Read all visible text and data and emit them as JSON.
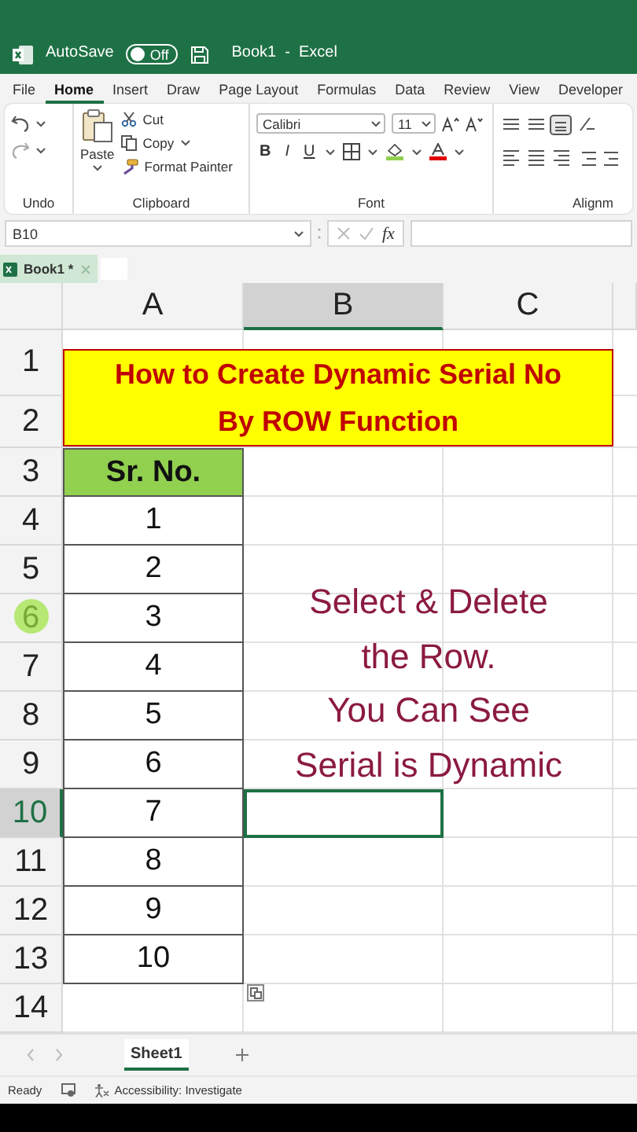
{
  "title_bar": {
    "autosave_label": "AutoSave",
    "autosave_state": "Off",
    "autosave_on": false,
    "document_title": "Book1  -  Excel"
  },
  "ribbon_tabs": [
    {
      "label": "File",
      "selected": false
    },
    {
      "label": "Home",
      "selected": true
    },
    {
      "label": "Insert",
      "selected": false
    },
    {
      "label": "Draw",
      "selected": false
    },
    {
      "label": "Page Layout",
      "selected": false
    },
    {
      "label": "Formulas",
      "selected": false
    },
    {
      "label": "Data",
      "selected": false
    },
    {
      "label": "Review",
      "selected": false
    },
    {
      "label": "View",
      "selected": false
    },
    {
      "label": "Developer",
      "selected": false
    }
  ],
  "ribbon": {
    "undo_group": "Undo",
    "paste": "Paste",
    "cut": "Cut",
    "copy": "Copy",
    "format_painter": "Format Painter",
    "clipboard_group": "Clipboard",
    "font_name": "Calibri",
    "font_size": "11",
    "bold": "B",
    "italic": "I",
    "underline": "U",
    "font_group": "Font",
    "alignment_group": "Alignm"
  },
  "formula_bar": {
    "name_box": "B10",
    "fx": "fx"
  },
  "workbook_tab": {
    "label": "Book1 *"
  },
  "sheet": {
    "columns": [
      {
        "label": "A",
        "selected": false
      },
      {
        "label": "B",
        "selected": true
      },
      {
        "label": "C",
        "selected": false
      }
    ],
    "rows": [
      {
        "number": "1",
        "selected": false,
        "pointer": false
      },
      {
        "number": "2",
        "selected": false,
        "pointer": false
      },
      {
        "number": "3",
        "selected": false,
        "pointer": false
      },
      {
        "number": "4",
        "selected": false,
        "pointer": false
      },
      {
        "number": "5",
        "selected": false,
        "pointer": false
      },
      {
        "number": "6",
        "selected": false,
        "pointer": true
      },
      {
        "number": "7",
        "selected": false,
        "pointer": false
      },
      {
        "number": "8",
        "selected": false,
        "pointer": false
      },
      {
        "number": "9",
        "selected": false,
        "pointer": false
      },
      {
        "number": "10",
        "selected": true,
        "pointer": false
      },
      {
        "number": "11",
        "selected": false,
        "pointer": false
      },
      {
        "number": "12",
        "selected": false,
        "pointer": false
      },
      {
        "number": "13",
        "selected": false,
        "pointer": false
      },
      {
        "number": "14",
        "selected": false,
        "pointer": false
      }
    ],
    "title": "How to Create Dynamic Serial No By ROW Function",
    "table_header": "Sr. No.",
    "serials": [
      "1",
      "2",
      "3",
      "4",
      "5",
      "6",
      "7",
      "8",
      "9",
      "10"
    ],
    "note_lines": [
      "Select & Delete",
      "the Row.",
      "You Can See",
      "Serial is Dynamic"
    ]
  },
  "sheet_tabs": [
    {
      "label": "Sheet1",
      "selected": true
    }
  ],
  "status_bar": {
    "mode": "Ready",
    "accessibility": "Accessibility: Investigate"
  }
}
